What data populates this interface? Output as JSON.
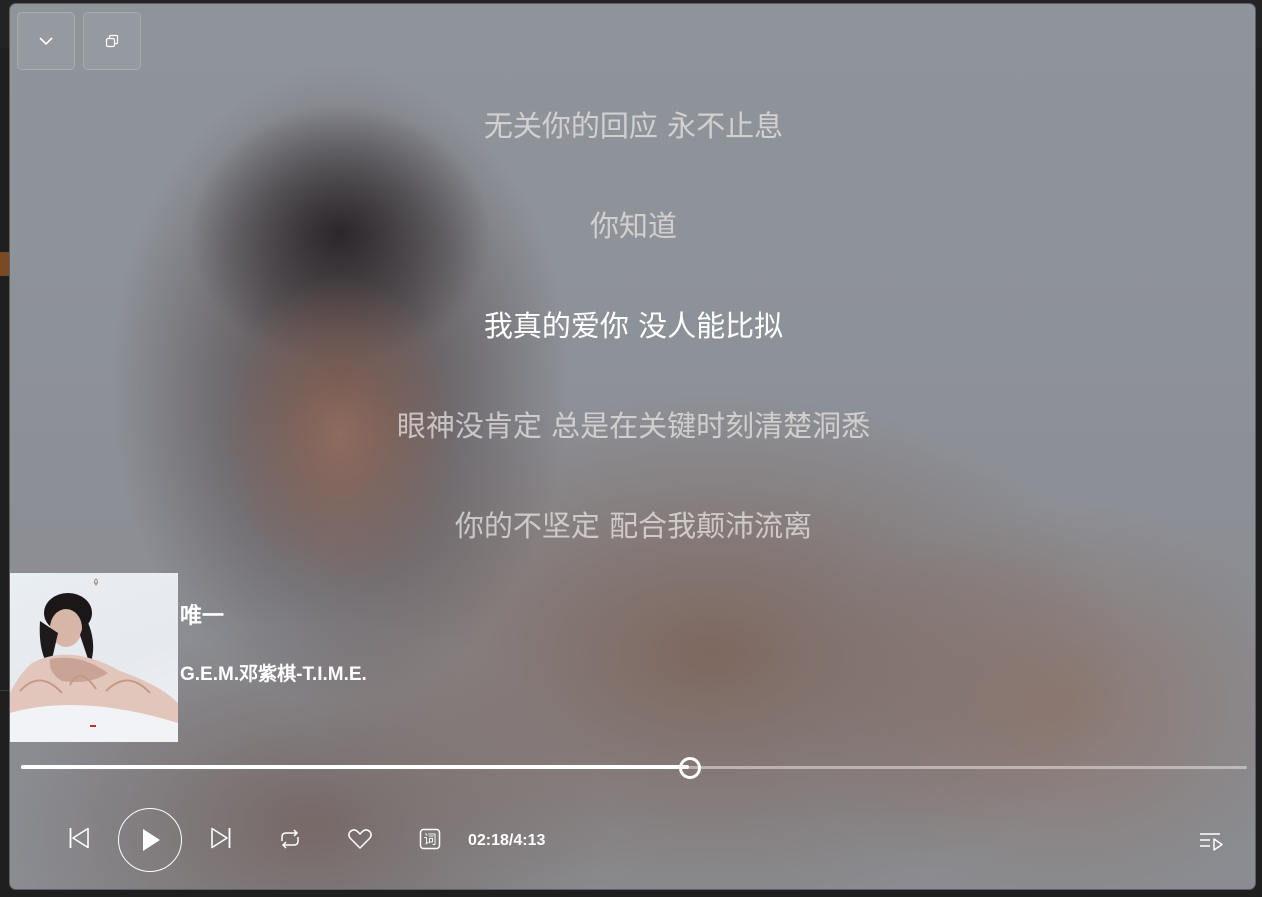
{
  "window": {
    "collapse_icon": "chevron-down-icon",
    "restore_icon": "restore-window-icon"
  },
  "lyrics": [
    {
      "text": "无关你的回应 永不止息",
      "active": false
    },
    {
      "text": "你知道",
      "active": false
    },
    {
      "text": "我真的爱你 没人能比拟",
      "active": true
    },
    {
      "text": "眼神没肯定 总是在关键时刻清楚洞悉",
      "active": false
    },
    {
      "text": "你的不坚定 配合我颠沛流离",
      "active": false
    }
  ],
  "now_playing": {
    "title": "唯一",
    "artist_album": "G.E.M.邓紫棋-T.I.M.E."
  },
  "progress": {
    "fraction": 0.545
  },
  "controls": {
    "previous_icon": "skip-previous-icon",
    "play_icon": "play-icon",
    "next_icon": "skip-next-icon",
    "repeat_icon": "repeat-icon",
    "favorite_icon": "heart-icon",
    "lyrics_icon": "lyrics-icon",
    "playlist_icon": "playlist-icon",
    "time": "02:18/4:13"
  }
}
